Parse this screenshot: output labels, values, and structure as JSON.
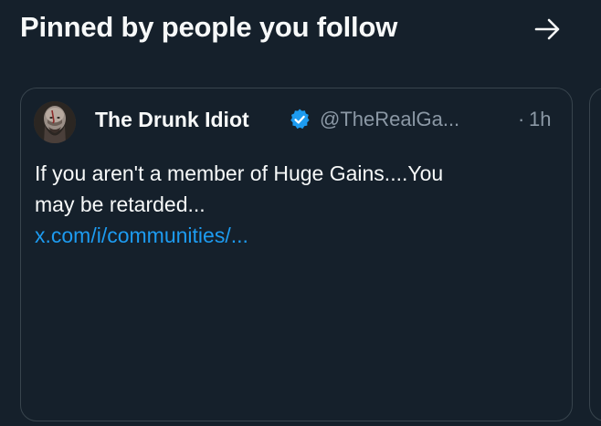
{
  "header": {
    "title": "Pinned by people you follow",
    "arrow_icon": "arrow-right-icon"
  },
  "pinned_post": {
    "author": {
      "display_name": "The Drunk Idiot",
      "verified_icon": "verified-badge-icon",
      "handle": "@TheRealGa...",
      "separator": "·",
      "time": "1h"
    },
    "text_line_1": "If you aren't a member of Huge Gains....You",
    "text_line_2": "may be retarded...",
    "link": "x.com/i/communities/..."
  },
  "colors": {
    "background": "#15202b",
    "text_primary": "#f7f9f9",
    "text_secondary": "#8b98a5",
    "accent_link": "#1d9bf0",
    "border": "#38444d"
  }
}
